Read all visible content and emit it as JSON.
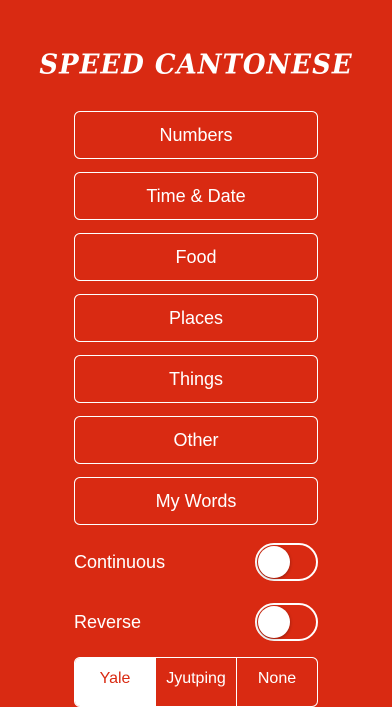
{
  "app": {
    "title": "SPEED CANTONESE",
    "background_color": "#d92a12"
  },
  "menu": {
    "items": [
      {
        "label": "Numbers"
      },
      {
        "label": "Time & Date"
      },
      {
        "label": "Food"
      },
      {
        "label": "Places"
      },
      {
        "label": "Things"
      },
      {
        "label": "Other"
      },
      {
        "label": "My Words"
      }
    ]
  },
  "settings": {
    "continuous": {
      "label": "Continuous",
      "on": false
    },
    "reverse": {
      "label": "Reverse",
      "on": false
    }
  },
  "romanization": {
    "options": [
      "Yale",
      "Jyutping",
      "None"
    ],
    "selected": "Yale"
  }
}
